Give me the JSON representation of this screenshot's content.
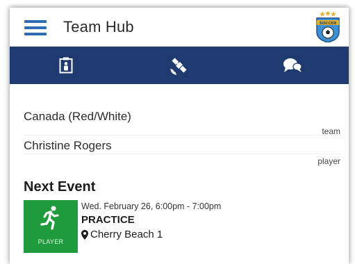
{
  "app": {
    "title": "Team Hub",
    "logo_icon": "soccer-team-crest",
    "logo_text": "SOCCER"
  },
  "tabs": [
    {
      "icon": "clipboard-roster-icon",
      "active": false
    },
    {
      "icon": "satellite-icon",
      "active": false
    },
    {
      "icon": "chat-bubbles-icon",
      "active": false
    }
  ],
  "fields": {
    "team": {
      "value": "Canada (Red/White)",
      "label": "team"
    },
    "player": {
      "value": "Christine Rogers",
      "label": "player"
    }
  },
  "next_event": {
    "heading": "Next Event",
    "tile_label": "PLAYER",
    "tile_icon": "runner-icon",
    "date": "Wed. February 26, 6:00pm - 7:00pm",
    "type": "PRACTICE",
    "location": "Cherry Beach 1",
    "location_icon": "map-pin-icon"
  },
  "colors": {
    "accent_blue": "#2f6bb3",
    "navbar": "#1e3a6e",
    "event_green": "#1f9a3c"
  }
}
